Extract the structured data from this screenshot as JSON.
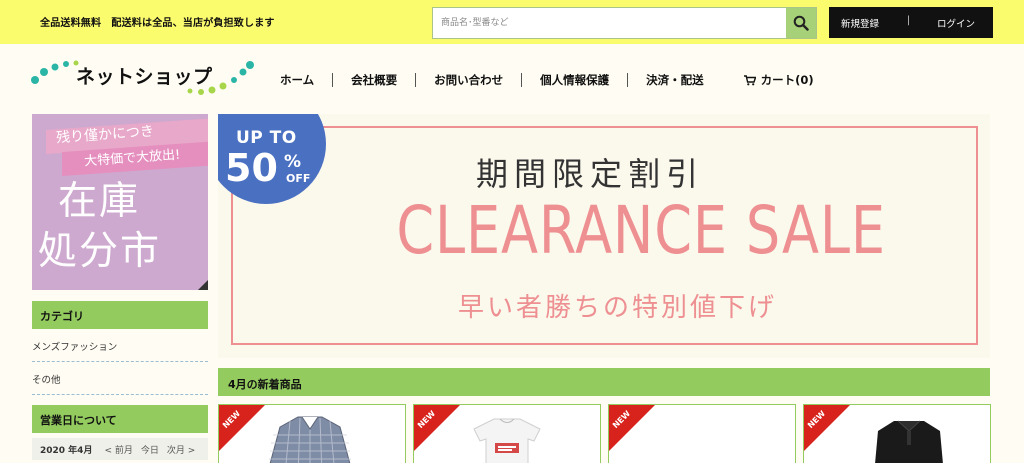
{
  "topbar": {
    "notice": "全品送料無料　配送料は全品、当店が負担致します",
    "search_placeholder": "商品名･型番など",
    "register": "新規登録",
    "separator": "|",
    "login": "ログイン"
  },
  "header": {
    "logo_text": "ネットショップ",
    "nav": [
      "ホーム",
      "会社概要",
      "お問い合わせ",
      "個人情報保護",
      "決済・配送"
    ],
    "cart_label": "カート(0)"
  },
  "sidebar": {
    "banner": {
      "line1": "残り僅かにつき",
      "line2": "大特価で大放出!",
      "big1": "在庫",
      "big2": "処分市"
    },
    "category_title": "カテゴリ",
    "categories": [
      "メンズファッション",
      "その他"
    ],
    "business_title": "営業日について",
    "calendar": {
      "month": "2020 年4月",
      "prev": "< 前月",
      "today": "今日",
      "next": "次月 >"
    }
  },
  "banner": {
    "badge_up": "UP TO",
    "badge_value": "50",
    "badge_percent": "%",
    "badge_off": "OFF",
    "heading": "期間限定割引",
    "sale": "CLEARANCE SALE",
    "subtitle": "早い者勝ちの特別値下げ"
  },
  "new_products": {
    "title": "4月の新着商品",
    "tag": "NEW"
  },
  "colors": {
    "topbar": "#fbfb6e",
    "accent_green": "#93cb5f",
    "banner_pink": "#ee8f92",
    "badge_blue": "#4a70c2",
    "new_red": "#d8231d"
  }
}
